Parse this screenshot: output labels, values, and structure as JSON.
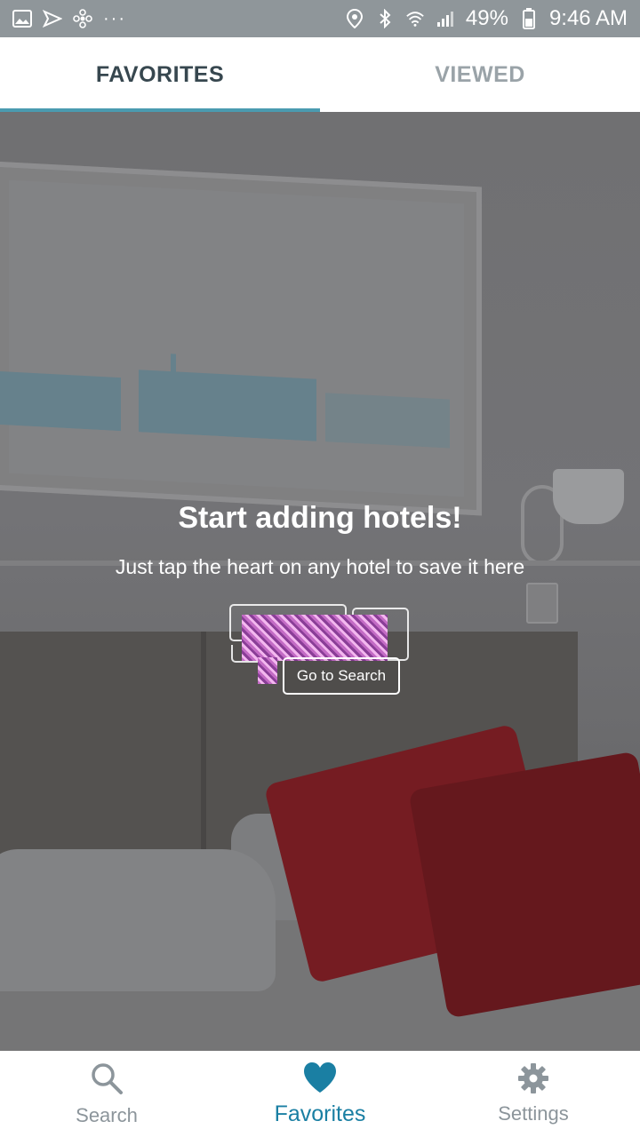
{
  "status_bar": {
    "left_icons": [
      "image-icon",
      "send-icon",
      "fan-icon",
      "more-dots-icon"
    ],
    "more_dots": "···",
    "battery_percent": "49%",
    "time": "9:46 AM",
    "right_icons": [
      "location-icon",
      "bluetooth-icon",
      "wifi-icon",
      "signal-icon",
      "battery-icon"
    ]
  },
  "tabs": [
    {
      "label": "FAVORITES",
      "active": true
    },
    {
      "label": "VIEWED",
      "active": false
    }
  ],
  "empty_state": {
    "title": "Start adding hotels!",
    "subtitle": "Just tap the heart on any hotel to save it here",
    "button_label": "Go to Search"
  },
  "bottom_nav": [
    {
      "label": "Search",
      "icon": "search-icon",
      "active": false
    },
    {
      "label": "Favorites",
      "icon": "heart-icon",
      "active": true
    },
    {
      "label": "Settings",
      "icon": "gear-icon",
      "active": false
    }
  ],
  "colors": {
    "accent": "#1a7fa3",
    "tab_indicator": "#4a9bb0",
    "status_bar": "#8f969a"
  }
}
